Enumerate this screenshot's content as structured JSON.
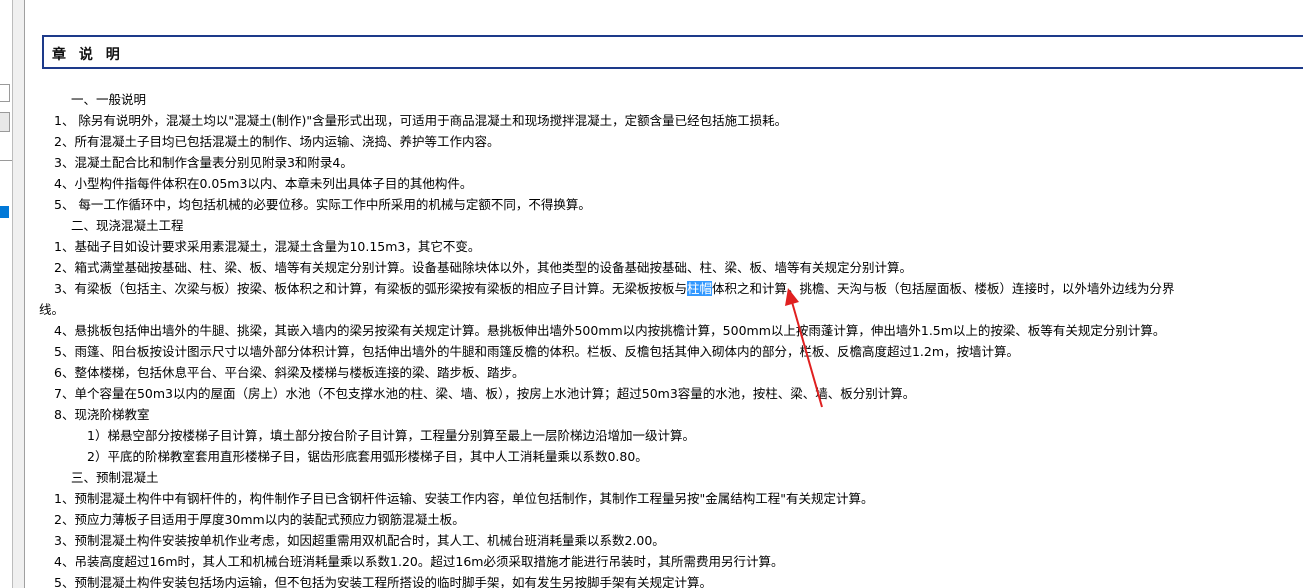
{
  "title": "章 说 明",
  "lines": [
    "一、一般说明",
    "1、  除另有说明外，混凝土均以\"混凝土(制作)\"含量形式出现，可适用于商品混凝土和现场搅拌混凝土，定额含量已经包括施工损耗。",
    "2、所有混凝土子目均已包括混凝土的制作、场内运输、浇捣、养护等工作内容。",
    "3、混凝土配合比和制作含量表分别见附录3和附录4。",
    "4、小型构件指每件体积在0.05m3以内、本章未列出具体子目的其他构件。",
    "5、  每一工作循环中，均包括机械的必要位移。实际工作中所采用的机械与定额不同，不得换算。",
    "二、现浇混凝土工程",
    "1、基础子目如设计要求采用素混凝土，混凝土含量为10.15m3，其它不变。",
    "2、箱式满堂基础按基础、柱、梁、板、墙等有关规定分别计算。设备基础除块体以外，其他类型的设备基础按基础、柱、梁、板、墙等有关规定分别计算。",
    {
      "before": "3、有梁板（包括主、次梁与板）按梁、板体积之和计算，有梁板的弧形梁按有梁板的相应子目计算。无梁板按板与",
      "highlight": "柱帽",
      "after": "体积之和计算。挑檐、天沟与板（包括屋面板、楼板）连接时，以外墙外边线为分界"
    },
    "线。",
    "4、悬挑板包括伸出墙外的牛腿、挑梁，其嵌入墙内的梁另按梁有关规定计算。悬挑板伸出墙外500mm以内按挑檐计算，500mm以上按雨蓬计算，伸出墙外1.5m以上的按梁、板等有关规定分别计算。",
    "5、雨篷、阳台板按设计图示尺寸以墙外部分体积计算，包括伸出墙外的牛腿和雨篷反檐的体积。栏板、反檐包括其伸入砌体内的部分，栏板、反檐高度超过1.2m，按墙计算。",
    "6、整体楼梯，包括休息平台、平台梁、斜梁及楼梯与楼板连接的梁、踏步板、踏步。",
    "7、单个容量在50m3以内的屋面（房上）水池（不包支撑水池的柱、梁、墙、板），按房上水池计算；超过50m3容量的水池，按柱、梁、墙、板分别计算。",
    "8、现浇阶梯教室",
    "1）梯悬空部分按楼梯子目计算，填土部分按台阶子目计算，工程量分别算至最上一层阶梯边沿增加一级计算。",
    "2）平底的阶梯教室套用直形楼梯子目，锯齿形底套用弧形楼梯子目，其中人工消耗量乘以系数0.80。",
    "三、预制混凝土",
    "1、预制混凝土构件中有钢杆件的，构件制作子目已含钢杆件运输、安装工作内容，单位包括制作，其制作工程量另按\"金属结构工程\"有关规定计算。",
    "2、预应力薄板子目适用于厚度30mm以内的装配式预应力钢筋混凝土板。",
    "3、预制混凝土构件安装按单机作业考虑，如因超重需用双机配合时，其人工、机械台班消耗量乘以系数2.00。",
    "4、吊装高度超过16m时，其人工和机械台班消耗量乘以系数1.20。超过16m必须采取措施才能进行吊装时，其所需费用另行计算。",
    "5、预制混凝土构件安装包括场内运输，但不包括为安装工程所搭设的临时脚手架，如有发生另按脚手架有关规定计算。"
  ],
  "colors": {
    "title_border": "#1d3a8a",
    "selection": "#3399ff",
    "arrow": "#e02020"
  }
}
